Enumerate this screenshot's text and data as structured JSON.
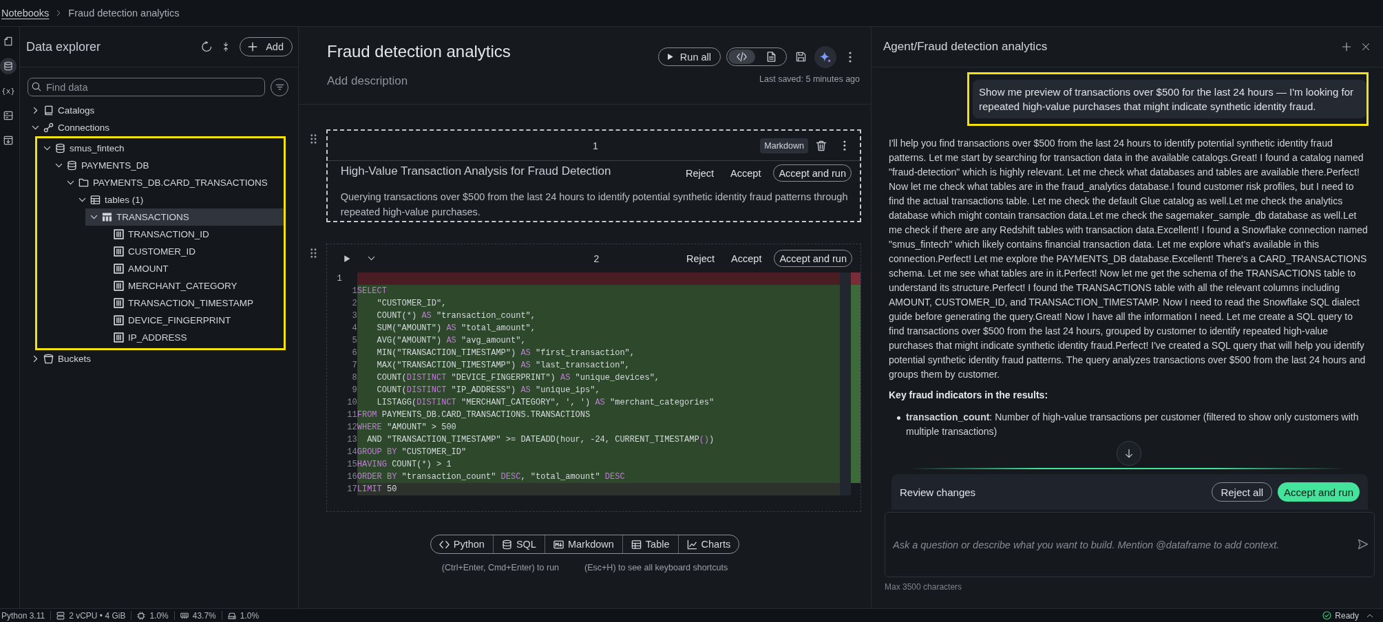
{
  "breadcrumb": [
    {
      "label": "Notebooks",
      "kind": "link"
    },
    {
      "label": "Fraud detection analytics",
      "kind": "current"
    }
  ],
  "rail": [
    {
      "kind": "notebook",
      "selected": false
    },
    {
      "kind": "database",
      "selected": true
    },
    {
      "kind": "variables",
      "glyph": "{x}",
      "selected": false
    },
    {
      "kind": "storage",
      "selected": false
    },
    {
      "kind": "archive",
      "selected": false
    }
  ],
  "data_explorer": {
    "title": "Data explorer",
    "add_button": "Add",
    "search": {
      "placeholder": "Find data"
    },
    "tree": [
      {
        "label": "Catalogs",
        "kind": "catalogs",
        "expanded": false,
        "selected": false,
        "highlighted": false
      },
      {
        "label": "Connections",
        "kind": "connections",
        "expanded": true,
        "selected": false,
        "highlighted": false,
        "children": [
          {
            "label": "smus_fintech",
            "kind": "database",
            "expanded": true,
            "selected": false,
            "highlighted": true,
            "children": [
              {
                "label": "PAYMENTS_DB",
                "kind": "database",
                "expanded": true,
                "selected": false,
                "highlighted": false,
                "children": [
                  {
                    "label": "PAYMENTS_DB.CARD_TRANSACTIONS",
                    "kind": "schema",
                    "expanded": true,
                    "selected": false,
                    "highlighted": false,
                    "children": [
                      {
                        "label": "tables (1)",
                        "kind": "tables",
                        "expanded": true,
                        "selected": false,
                        "highlighted": false,
                        "children": [
                          {
                            "label": "TRANSACTIONS",
                            "kind": "table",
                            "expanded": true,
                            "selected": true,
                            "highlighted": false,
                            "children": [
                              {
                                "label": "TRANSACTION_ID",
                                "kind": "column",
                                "selected": false,
                                "highlighted": false
                              },
                              {
                                "label": "CUSTOMER_ID",
                                "kind": "column",
                                "selected": false,
                                "highlighted": false
                              },
                              {
                                "label": "AMOUNT",
                                "kind": "column",
                                "selected": false,
                                "highlighted": false
                              },
                              {
                                "label": "MERCHANT_CATEGORY",
                                "kind": "column",
                                "selected": false,
                                "highlighted": false
                              },
                              {
                                "label": "TRANSACTION_TIMESTAMP",
                                "kind": "column",
                                "selected": false,
                                "highlighted": false
                              },
                              {
                                "label": "DEVICE_FINGERPRINT",
                                "kind": "column",
                                "selected": false,
                                "highlighted": false
                              },
                              {
                                "label": "IP_ADDRESS",
                                "kind": "column",
                                "selected": false,
                                "highlighted": false
                              }
                            ]
                          }
                        ]
                      }
                    ]
                  }
                ]
              }
            ]
          }
        ]
      },
      {
        "label": "Buckets",
        "kind": "buckets",
        "expanded": false,
        "selected": false,
        "highlighted": false
      }
    ]
  },
  "notebook": {
    "title": "Fraud detection analytics",
    "description": {
      "placeholder": "Add description"
    },
    "run_all": "Run all",
    "view_modes": [
      {
        "kind": "code",
        "selected": true
      },
      {
        "kind": "document",
        "selected": false
      }
    ],
    "last_saved": "Last saved: 5 minutes ago",
    "cells": [
      {
        "kind": "markdown",
        "number": "1",
        "type_label": "Markdown",
        "title": "High-Value Transaction Analysis for Fraud Detection",
        "text": "Querying transactions over $500 from the last 24 hours to identify potential synthetic identity fraud patterns through repeated high-value purchases.",
        "actions": [
          {
            "kind": "reject",
            "label": "Reject"
          },
          {
            "kind": "accept",
            "label": "Accept"
          },
          {
            "kind": "accept_run",
            "label": "Accept and run"
          }
        ]
      },
      {
        "kind": "code",
        "number": "2",
        "actions": [
          {
            "kind": "reject",
            "label": "Reject"
          },
          {
            "kind": "accept",
            "label": "Accept"
          },
          {
            "kind": "accept_run",
            "label": "Accept and run"
          }
        ],
        "lines": [
          {
            "kind": "removed",
            "old_number": "1"
          },
          {
            "kind": "added",
            "new_number": "1",
            "tokens": [
              {
                "text": "SELECT",
                "kind": "keyword"
              }
            ]
          },
          {
            "kind": "added",
            "new_number": "2",
            "tokens": [
              {
                "text": "    \"CUSTOMER_ID\",",
                "kind": "plain"
              }
            ]
          },
          {
            "kind": "added",
            "new_number": "3",
            "tokens": [
              {
                "text": "    COUNT(*) ",
                "kind": "plain"
              },
              {
                "text": "AS",
                "kind": "keyword"
              },
              {
                "text": " \"transaction_count\",",
                "kind": "plain"
              }
            ]
          },
          {
            "kind": "added",
            "new_number": "4",
            "tokens": [
              {
                "text": "    SUM(\"AMOUNT\") ",
                "kind": "plain"
              },
              {
                "text": "AS",
                "kind": "keyword"
              },
              {
                "text": " \"total_amount\",",
                "kind": "plain"
              }
            ]
          },
          {
            "kind": "added",
            "new_number": "5",
            "tokens": [
              {
                "text": "    AVG(\"AMOUNT\") ",
                "kind": "plain"
              },
              {
                "text": "AS",
                "kind": "keyword"
              },
              {
                "text": " \"avg_amount\",",
                "kind": "plain"
              }
            ]
          },
          {
            "kind": "added",
            "new_number": "6",
            "tokens": [
              {
                "text": "    MIN(\"TRANSACTION_TIMESTAMP\") ",
                "kind": "plain"
              },
              {
                "text": "AS",
                "kind": "keyword"
              },
              {
                "text": " \"first_transaction\",",
                "kind": "plain"
              }
            ]
          },
          {
            "kind": "added",
            "new_number": "7",
            "tokens": [
              {
                "text": "    MAX(\"TRANSACTION_TIMESTAMP\") ",
                "kind": "plain"
              },
              {
                "text": "AS",
                "kind": "keyword"
              },
              {
                "text": " \"last_transaction\",",
                "kind": "plain"
              }
            ]
          },
          {
            "kind": "added",
            "new_number": "8",
            "tokens": [
              {
                "text": "    COUNT(",
                "kind": "plain"
              },
              {
                "text": "DISTINCT",
                "kind": "keyword"
              },
              {
                "text": " \"DEVICE_FINGERPRINT\") ",
                "kind": "plain"
              },
              {
                "text": "AS",
                "kind": "keyword"
              },
              {
                "text": " \"unique_devices\",",
                "kind": "plain"
              }
            ]
          },
          {
            "kind": "added",
            "new_number": "9",
            "tokens": [
              {
                "text": "    COUNT(",
                "kind": "plain"
              },
              {
                "text": "DISTINCT",
                "kind": "keyword"
              },
              {
                "text": " \"IP_ADDRESS\") ",
                "kind": "plain"
              },
              {
                "text": "AS",
                "kind": "keyword"
              },
              {
                "text": " \"unique_ips\",",
                "kind": "plain"
              }
            ]
          },
          {
            "kind": "added",
            "new_number": "10",
            "tokens": [
              {
                "text": "    LISTAGG(",
                "kind": "plain"
              },
              {
                "text": "DISTINCT",
                "kind": "keyword"
              },
              {
                "text": " \"MERCHANT_CATEGORY\", ', ') ",
                "kind": "plain"
              },
              {
                "text": "AS",
                "kind": "keyword"
              },
              {
                "text": " \"merchant_categories\"",
                "kind": "plain"
              }
            ]
          },
          {
            "kind": "added",
            "new_number": "11",
            "tokens": [
              {
                "text": "FROM",
                "kind": "keyword"
              },
              {
                "text": " PAYMENTS_DB.CARD_TRANSACTIONS.TRANSACTIONS",
                "kind": "plain"
              }
            ]
          },
          {
            "kind": "added",
            "new_number": "12",
            "tokens": [
              {
                "text": "WHERE",
                "kind": "keyword"
              },
              {
                "text": " \"AMOUNT\" > 500",
                "kind": "plain"
              }
            ]
          },
          {
            "kind": "added",
            "new_number": "13",
            "tokens": [
              {
                "text": "  AND \"TRANSACTION_TIMESTAMP\" >= DATEADD(hour, -24, CURRENT_TIMESTAMP",
                "kind": "plain"
              },
              {
                "text": "()",
                "kind": "keyword"
              },
              {
                "text": ")",
                "kind": "plain"
              }
            ]
          },
          {
            "kind": "added",
            "new_number": "14",
            "tokens": [
              {
                "text": "GROUP BY",
                "kind": "keyword"
              },
              {
                "text": " \"CUSTOMER_ID\"",
                "kind": "plain"
              }
            ]
          },
          {
            "kind": "added",
            "new_number": "15",
            "tokens": [
              {
                "text": "HAVING",
                "kind": "keyword"
              },
              {
                "text": " COUNT(*) > 1",
                "kind": "plain"
              }
            ]
          },
          {
            "kind": "added",
            "new_number": "16",
            "tokens": [
              {
                "text": "ORDER BY",
                "kind": "keyword"
              },
              {
                "text": " \"transaction_count\" ",
                "kind": "plain"
              },
              {
                "text": "DESC",
                "kind": "keyword"
              },
              {
                "text": ", \"total_amount\" ",
                "kind": "plain"
              },
              {
                "text": "DESC",
                "kind": "keyword"
              }
            ]
          },
          {
            "kind": "active",
            "new_number": "17",
            "tokens": [
              {
                "text": "LIMIT",
                "kind": "keyword"
              },
              {
                "text": " 50",
                "kind": "plain"
              }
            ]
          }
        ]
      }
    ],
    "add_cell": [
      {
        "kind": "python",
        "label": "Python"
      },
      {
        "kind": "sql",
        "label": "SQL"
      },
      {
        "kind": "markdown",
        "label": "Markdown"
      },
      {
        "kind": "table",
        "label": "Table"
      },
      {
        "kind": "charts",
        "label": "Charts"
      }
    ],
    "hints": [
      "(Ctrl+Enter, Cmd+Enter) to run",
      "(Esc+H) to see all keyboard shortcuts"
    ]
  },
  "agent": {
    "title": "Agent/Fraud detection analytics",
    "messages": [
      {
        "kind": "user",
        "highlighted": true,
        "text": "Show me preview of transactions over $500 for the last 24 hours — I'm looking for repeated high-value purchases that might indicate synthetic identity fraud."
      },
      {
        "kind": "assistant",
        "highlighted": false,
        "blocks": [
          {
            "kind": "paragraph",
            "text": "I'll help you find transactions over $500 from the last 24 hours to identify potential synthetic identity fraud patterns. Let me start by searching for transaction data in the available catalogs.Great! I found a catalog named \"fraud-detection\" which is highly relevant. Let me check what databases and tables are available there.Perfect! Now let me check what tables are in the fraud_analytics database.I found customer risk profiles, but I need to find the actual transactions table. Let me check the default Glue catalog as well.Let me check the analytics database which might contain transaction data.Let me check the sagemaker_sample_db database as well.Let me check if there are any Redshift tables with transaction data.Excellent! I found a Snowflake connection named \"smus_fintech\" which likely contains financial transaction data. Let me explore what's available in this connection.Perfect! Let me explore the PAYMENTS_DB database.Excellent! There's a CARD_TRANSACTIONS schema. Let me see what tables are in it.Perfect! Now let me get the schema of the TRANSACTIONS table to understand its structure.Perfect! I found the TRANSACTIONS table with all the relevant columns including AMOUNT, CUSTOMER_ID, and TRANSACTION_TIMESTAMP. Now I need to read the Snowflake SQL dialect guide before generating the query.Great! Now I have all the information I need. Let me create a SQL query to find transactions over $500 from the last 24 hours, grouped by customer to identify repeated high-value purchases that might indicate synthetic identity fraud.Perfect! I've created a SQL query that will help you identify potential synthetic identity fraud patterns. The query analyzes transactions over $500 from the last 24 hours and groups them by customer."
          },
          {
            "kind": "heading",
            "text": "Key fraud indicators in the results:"
          },
          {
            "kind": "bullets",
            "items": [
              "**transaction_count**: Number of high-value transactions per customer (filtered to show only customers with multiple transactions)"
            ]
          }
        ]
      }
    ],
    "review": {
      "label": "Review changes",
      "actions": [
        {
          "kind": "reject_all",
          "label": "Reject all"
        },
        {
          "kind": "accept_run",
          "label": "Accept and run"
        }
      ]
    },
    "composer": {
      "placeholder": "Ask a question or describe what you want to build. Mention @dataframe to add context.",
      "note": "Max 3500 characters"
    }
  },
  "status_bar": {
    "kernel": "Python 3.11",
    "resources": [
      {
        "kind": "compute",
        "text": "2 vCPU • 4 GiB"
      },
      {
        "kind": "cpu",
        "text": "1.0%"
      },
      {
        "kind": "memory",
        "text": "43.7%"
      },
      {
        "kind": "disk",
        "text": "1.0%"
      }
    ],
    "status": "Ready"
  }
}
